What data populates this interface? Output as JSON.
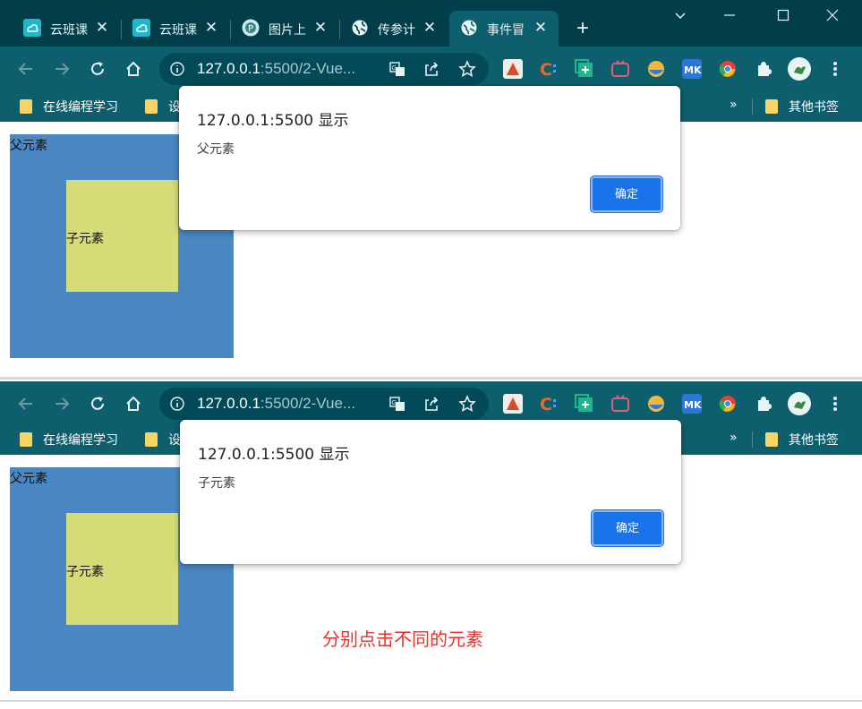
{
  "tabs": [
    {
      "title": "云班课",
      "icon": "cloud-class-icon",
      "close": "✕"
    },
    {
      "title": "云班课",
      "icon": "cloud-class-icon",
      "close": "✕"
    },
    {
      "title": "图片上",
      "icon": "picture-upload-icon",
      "close": "✕"
    },
    {
      "title": "传参计",
      "icon": "globe-icon",
      "close": "✕"
    },
    {
      "title": "事件冒",
      "icon": "globe-icon",
      "close": "✕",
      "active": true
    }
  ],
  "new_tab": "+",
  "window_controls": {
    "dropdown": "⌄",
    "minimize": "—",
    "maximize": "☐",
    "close": "✕"
  },
  "address": {
    "host": "127.0.0.1",
    "rest": ":5500/2-Vue..."
  },
  "bookmarks": {
    "item1": "在线编程学习",
    "item2": "设",
    "overflow": "»",
    "other": "其他书签"
  },
  "colors": {
    "frame": "#023e4a",
    "toolbar": "#0d5f6e",
    "parent": "#4a87c3",
    "child": "#d5db77",
    "button": "#1a73e8",
    "annotation": "#e8302a"
  },
  "windows": [
    {
      "parent_label": "父元素",
      "child_label": "子元素",
      "dialog": {
        "title": "127.0.0.1:5500 显示",
        "message": "父元素",
        "ok": "确定"
      }
    },
    {
      "parent_label": "父元素",
      "child_label": "子元素",
      "dialog": {
        "title": "127.0.0.1:5500 显示",
        "message": "子元素",
        "ok": "确定"
      }
    }
  ],
  "annotation": "分别点击不同的元素"
}
